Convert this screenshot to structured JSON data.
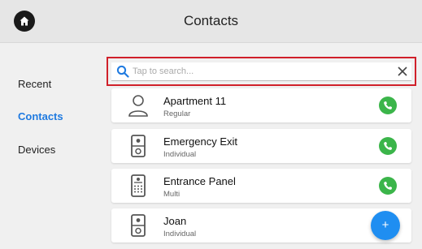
{
  "header": {
    "title": "Contacts",
    "home_icon": "home-icon"
  },
  "sidebar": {
    "items": [
      {
        "label": "Recent",
        "active": false
      },
      {
        "label": "Contacts",
        "active": true
      },
      {
        "label": "Devices",
        "active": false
      }
    ]
  },
  "search": {
    "placeholder": "Tap to search...",
    "value": "",
    "icon": "search-icon",
    "clear_icon": "close-icon"
  },
  "contacts": [
    {
      "name": "Apartment 11",
      "type": "Regular",
      "icon": "person-icon"
    },
    {
      "name": "Emergency Exit",
      "type": "Individual",
      "icon": "intercom-icon"
    },
    {
      "name": "Entrance Panel",
      "type": "Multi",
      "icon": "keypad-panel-icon"
    },
    {
      "name": "Joan",
      "type": "Individual",
      "icon": "intercom-icon"
    }
  ],
  "fab": {
    "label": "+"
  },
  "colors": {
    "accent": "#1f7ae0",
    "call": "#3bb54a",
    "highlight": "#d0202a",
    "fab": "#1f8ef1"
  }
}
